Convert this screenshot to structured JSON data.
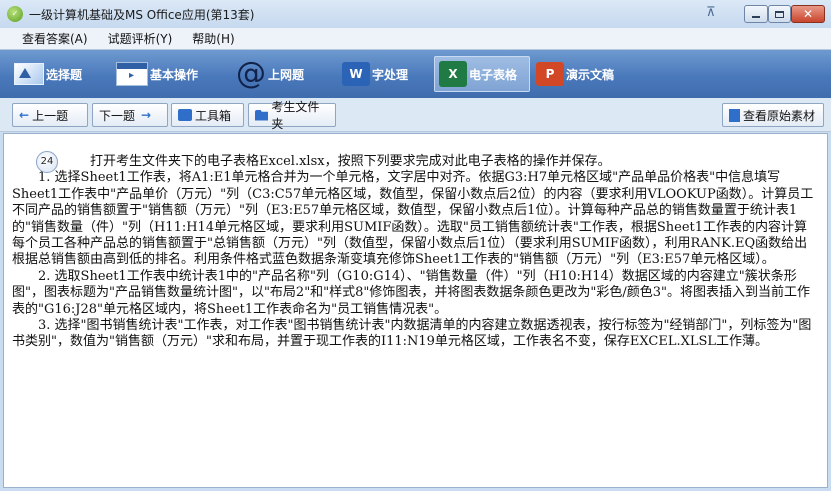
{
  "window": {
    "title": "一级计算机基础及MS Office应用(第13套)",
    "pin_glyph": "⊼",
    "close_glyph": "✕"
  },
  "menu": [
    "查看答案(A)",
    "试题评析(Y)",
    "帮助(H)"
  ],
  "ribbon": {
    "items": [
      {
        "label": "选择题",
        "icon": "select-icon"
      },
      {
        "label": "基本操作",
        "icon": "basic-ops-icon"
      },
      {
        "label": "上网题",
        "icon": "internet-icon",
        "glyph": "@"
      },
      {
        "label": "字处理",
        "icon": "word-icon",
        "glyph": "W"
      },
      {
        "label": "电子表格",
        "icon": "excel-icon",
        "glyph": "X",
        "active": true
      },
      {
        "label": "演示文稿",
        "icon": "ppt-icon",
        "glyph": "P"
      }
    ]
  },
  "toolbar": {
    "prev": "上一题",
    "prev_glyph": "←",
    "next": "下一题",
    "next_glyph": "→",
    "toolbox": "工具箱",
    "folder": "考生文件夹",
    "view_source": "查看原始素材"
  },
  "question": {
    "number": "24",
    "intro": "打开考生文件夹下的电子表格Excel.xlsx，按照下列要求完成对此电子表格的操作并保存。",
    "p1": "1. 选择Sheet1工作表，将A1:E1单元格合并为一个单元格，文字居中对齐。依据G3:H7单元格区域\"产品单品价格表\"中信息填写Sheet1工作表中\"产品单价（万元）\"列（C3:C57单元格区域，数值型，保留小数点后2位）的内容（要求利用VLOOKUP函数）。计算员工不同产品的销售额置于\"销售额（万元）\"列（E3:E57单元格区域，数值型，保留小数点后1位）。计算每种产品总的销售数量置于统计表1的\"销售数量（件）\"列（H11:H14单元格区域，要求利用SUMIF函数）。选取\"员工销售额统计表\"工作表，根据Sheet1工作表的内容计算每个员工各种产品总的销售额置于\"总销售额（万元）\"列（数值型，保留小数点后1位）（要求利用SUMIF函数），利用RANK.EQ函数给出根据总销售额由高到低的排名。利用条件格式蓝色数据条渐变填充修饰Sheet1工作表的\"销售额（万元）\"列（E3:E57单元格区域）。",
    "p2": "2. 选取Sheet1工作表中统计表1中的\"产品名称\"列（G10:G14）、\"销售数量（件）\"列（H10:H14）数据区域的内容建立\"簇状条形图\"，图表标题为\"产品销售数量统计图\"，以\"布局2\"和\"样式8\"修饰图表，并将图表数据条颜色更改为\"彩色/颜色3\"。将图表插入到当前工作表的\"G16:J28\"单元格区域内，将Sheet1工作表命名为\"员工销售情况表\"。",
    "p3": "3. 选择\"图书销售统计表\"工作表，对工作表\"图书销售统计表\"内数据清单的内容建立数据透视表，按行标签为\"经销部门\"，列标签为\"图书类别\"，数值为\"销售额（万元）\"求和布局，并置于现工作表的I11:N19单元格区域，工作表名不变，保存EXCEL.XLSL工作薄。"
  }
}
